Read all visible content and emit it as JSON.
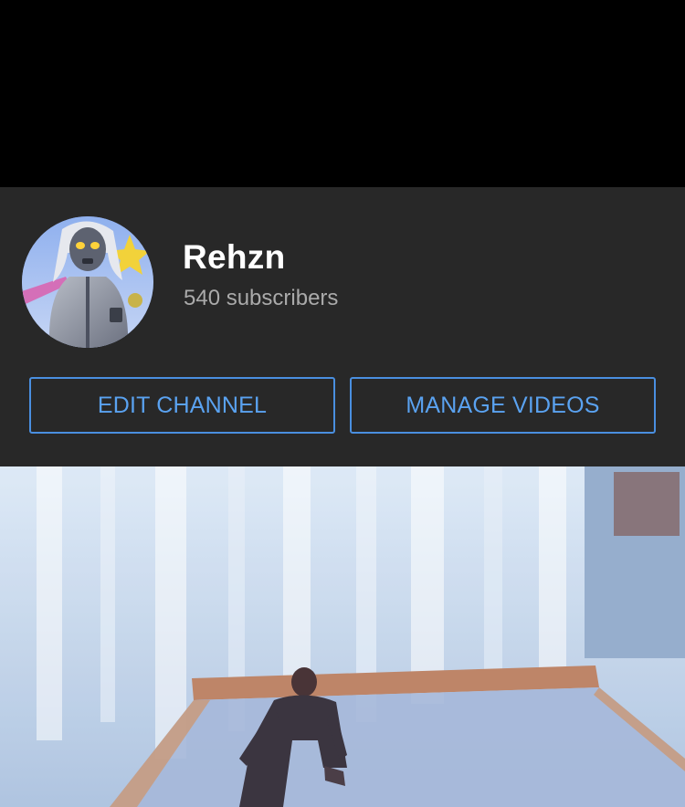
{
  "channel": {
    "name": "Rehzn",
    "subscribers": "540 subscribers",
    "avatar_icon": "character-avatar-icon"
  },
  "actions": {
    "edit_channel_label": "EDIT CHANNEL",
    "manage_videos_label": "MANAGE VIDEOS"
  },
  "colors": {
    "background": "#000000",
    "panel": "#282828",
    "accent": "#4a8fe0",
    "primary_text": "#ffffff",
    "secondary_text": "#aaaaaa"
  },
  "video": {
    "thumbnail_icon": "game-scene-thumbnail"
  }
}
